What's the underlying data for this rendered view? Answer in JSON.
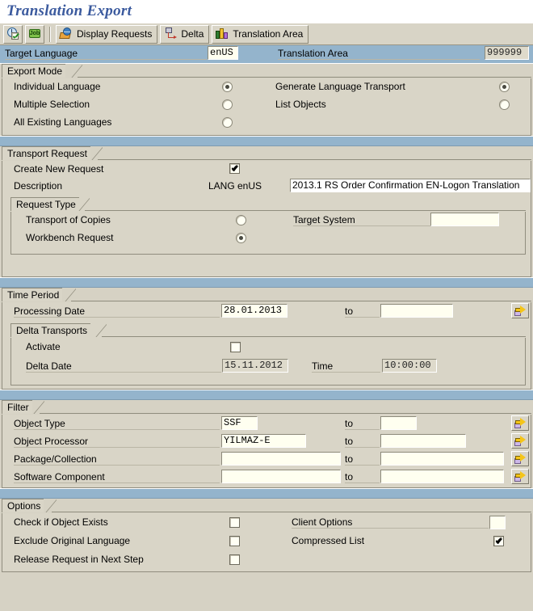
{
  "window": {
    "title": "Translation Export"
  },
  "toolbar": {
    "buttons": [
      {
        "name": "execute-button",
        "icon": "clock-check-icon",
        "label": ""
      },
      {
        "name": "execute-background-button",
        "icon": "job-icon",
        "label": ""
      },
      {
        "name": "display-requests-button",
        "icon": "display-requests-icon",
        "label": "Display Requests"
      },
      {
        "name": "delta-button",
        "icon": "delta-icon",
        "label": "Delta"
      },
      {
        "name": "translation-area-button",
        "icon": "translation-area-icon",
        "label": "Translation Area"
      }
    ],
    "job_icon_text": "Job"
  },
  "header": {
    "target_language_label": "Target Language",
    "target_language_value": "enUS",
    "translation_area_label": "Translation Area",
    "translation_area_value": "999999"
  },
  "export_mode": {
    "title": "Export Mode",
    "left_options": [
      {
        "label": "Individual Language",
        "selected": true
      },
      {
        "label": "Multiple Selection",
        "selected": false
      },
      {
        "label": "All Existing Languages",
        "selected": false
      }
    ],
    "right_options": [
      {
        "label": "Generate Language Transport",
        "selected": true
      },
      {
        "label": "List Objects",
        "selected": false
      }
    ]
  },
  "transport_request": {
    "title": "Transport Request",
    "create_new_request_label": "Create New Request",
    "create_new_request_checked": true,
    "description_label": "Description",
    "description_prefix": "LANG enUS",
    "description_value": "2013.1 RS Order Confirmation EN-Logon Translation",
    "request_type": {
      "title": "Request Type",
      "options": [
        {
          "label": "Transport of Copies",
          "selected": false
        },
        {
          "label": "Workbench Request",
          "selected": true
        }
      ],
      "target_system_label": "Target System",
      "target_system_value": ""
    }
  },
  "time_period": {
    "title": "Time Period",
    "processing_date_label": "Processing Date",
    "processing_date_from": "28.01.2013",
    "to_label": "to",
    "processing_date_to": "",
    "delta_transports": {
      "title": "Delta Transports",
      "activate_label": "Activate",
      "activate_checked": false,
      "delta_date_label": "Delta Date",
      "delta_date_value": "15.11.2012",
      "time_label": "Time",
      "time_value": "10:00:00"
    }
  },
  "filter": {
    "title": "Filter",
    "to_label": "to",
    "rows": [
      {
        "label": "Object Type",
        "from": "SSF",
        "to": ""
      },
      {
        "label": "Object Processor",
        "from": "YILMAZ-E",
        "to": ""
      },
      {
        "label": "Package/Collection",
        "from": "",
        "to": ""
      },
      {
        "label": "Software Component",
        "from": "",
        "to": ""
      }
    ]
  },
  "options": {
    "title": "Options",
    "left": [
      {
        "label": "Check if Object Exists",
        "checked": false
      },
      {
        "label": "Exclude Original Language",
        "checked": false
      },
      {
        "label": "Release Request in Next Step",
        "checked": false
      }
    ],
    "right": [
      {
        "label": "Client Options",
        "type": "input",
        "value": ""
      },
      {
        "label": "Compressed List",
        "type": "checkbox",
        "checked": true
      }
    ]
  },
  "colors": {
    "title_blue": "#3b5a9e",
    "band_blue": "#94b4cc",
    "panel_beige": "#d9d5c7",
    "field_cream": "#fffff0",
    "field_disabled": "#dedacb",
    "accent_yellow": "#f5c518"
  }
}
